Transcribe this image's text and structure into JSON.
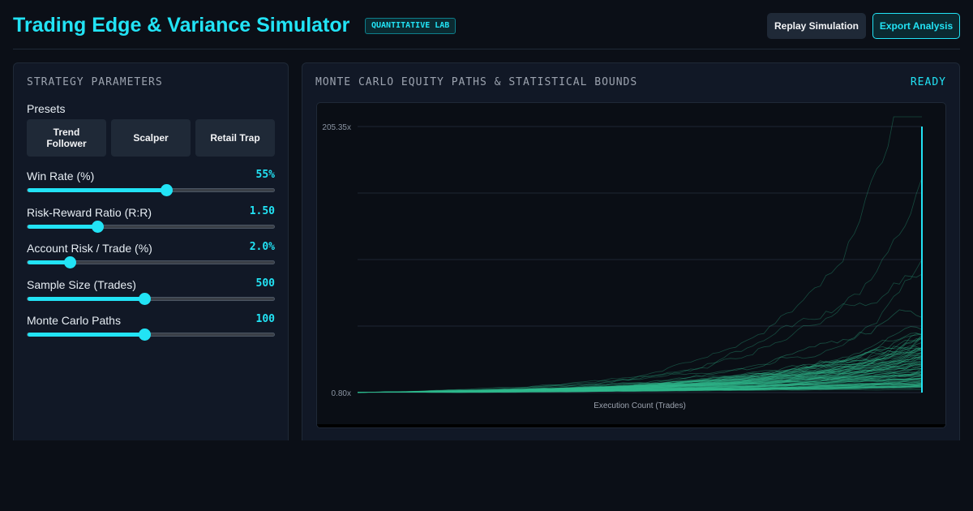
{
  "header": {
    "title": "Trading Edge & Variance Simulator",
    "badge": "QUANTITATIVE LAB",
    "replay_label": "Replay Simulation",
    "export_label": "Export Analysis"
  },
  "params_panel": {
    "heading": "STRATEGY PARAMETERS",
    "presets_label": "Presets",
    "presets": [
      "Trend Follower",
      "Scalper",
      "Retail Trap"
    ],
    "sliders": [
      {
        "label": "Win Rate (%)",
        "value": "55%",
        "fraction": 0.56
      },
      {
        "label": "Risk-Reward Ratio (R:R)",
        "value": "1.50",
        "fraction": 0.28
      },
      {
        "label": "Account Risk / Trade (%)",
        "value": "2.0%",
        "fraction": 0.17
      },
      {
        "label": "Sample Size (Trades)",
        "value": "500",
        "fraction": 0.47
      },
      {
        "label": "Monte Carlo Paths",
        "value": "100",
        "fraction": 0.47
      }
    ]
  },
  "chart_panel": {
    "heading": "MONTE CARLO EQUITY PATHS & STATISTICAL BOUNDS",
    "status": "READY"
  },
  "chart_data": {
    "type": "line",
    "xlabel": "Execution Count (Trades)",
    "ylabel": "",
    "y_tick_labels": [
      "205.35x",
      "0.80x"
    ],
    "ylim": [
      0.8,
      205.35
    ],
    "xlim": [
      0,
      500
    ],
    "grid": true,
    "paths": 100,
    "max_final_equity": 205.35,
    "typical_final_equity_range": [
      5,
      45
    ],
    "colors": {
      "paths": "#2fb98b",
      "accent": "#22e3f5",
      "grid": "#1e2633"
    }
  },
  "colors": {
    "accent": "#22e3f5",
    "background": "#0b0f17",
    "panel": "#111826",
    "button": "#1f2937"
  }
}
